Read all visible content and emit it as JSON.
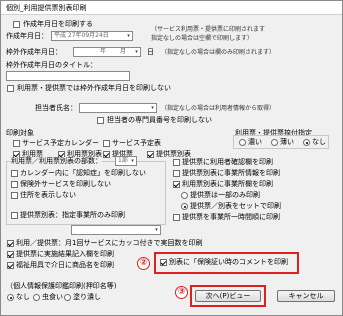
{
  "window": {
    "title": "個別_利用提供票別表印刷"
  },
  "top": {
    "creation_date_print_label": "作成年月日を印刷する",
    "creation_date_label": "作成年月日：",
    "creation_date_value": "平成 27年09月24日",
    "creation_date_note": "（サービス利用票・提供票に印刷されます",
    "creation_date_note2": "指定なしの場合は空欄で印刷します）"
  },
  "other": {
    "label": "枠外作成年月日：",
    "year": "年",
    "month": "月",
    "day": "日",
    "note": "（指定なしの場合は欄のみ印刷されます）",
    "title_label": "枠外作成年月日のタイトル：",
    "no_print_label": "利用票・提供票では枠外作成年月日を印刷しない"
  },
  "manager": {
    "label": "担当者氏名：",
    "note": "（指定なしの場合は利用者情報から取得）",
    "specialist_label": "担当者の専門員番号を印刷しない"
  },
  "print_target": {
    "label": "印刷対象",
    "items": [
      "サービス予定カレンダー",
      "サービス予定表",
      "利用票",
      "利用票別表",
      "提供票",
      "提供票別表"
    ],
    "states": [
      false,
      false,
      true,
      true,
      true,
      true
    ]
  },
  "company_stamp": {
    "label": "利用票・提供票捺付指定",
    "options": [
      "濃い",
      "薄い",
      "なし"
    ],
    "selected": 2
  },
  "left_opts": {
    "copies_label": "利用票／利用票別表の部数：",
    "copies_value": "1部",
    "items": [
      "カレンダー内に「認知症」を印刷しない",
      "保険外サービスを印刷しない",
      "住所を表示しない"
    ],
    "states": [
      false,
      false,
      false
    ],
    "attachment_label": "提供票別表：指定事業所のみ印刷",
    "attachment_state": false
  },
  "right_opts": {
    "items": [
      "提供票に利用者確認欄を印刷",
      "提供票別表に事業所情報を印刷",
      "利用票別表に事業所欄を印刷",
      "提供票は一部のみ印刷",
      "提供票／別表をセットで印刷",
      "提供票を事業所一時間順に印刷"
    ],
    "states": [
      false,
      false,
      true,
      false,
      false,
      false
    ],
    "radio_states": [
      false,
      true
    ]
  },
  "bottom_opts": {
    "items": [
      "利用／提供票：月1回サービスにカッコ付きで実回数を印刷",
      "提供票に実施結果記入欄を印刷",
      "福祉用具で介日に商品名を印刷"
    ],
    "states": [
      true,
      true,
      true
    ],
    "comment_label": "別表に「保険証い時のコメントを印刷",
    "comment_state": true
  },
  "stamp": {
    "label": "（個人情報保護印鑑印刷(押印名等)",
    "options": [
      "なし",
      "虫食い",
      "塗り潰し"
    ],
    "selected": 0
  },
  "buttons": {
    "next": "次へ(P)ビュー",
    "cancel": "キャンセル"
  },
  "annotations": {
    "step2": "②",
    "step3": "③"
  },
  "colors": {
    "highlight": "#e0201c"
  }
}
